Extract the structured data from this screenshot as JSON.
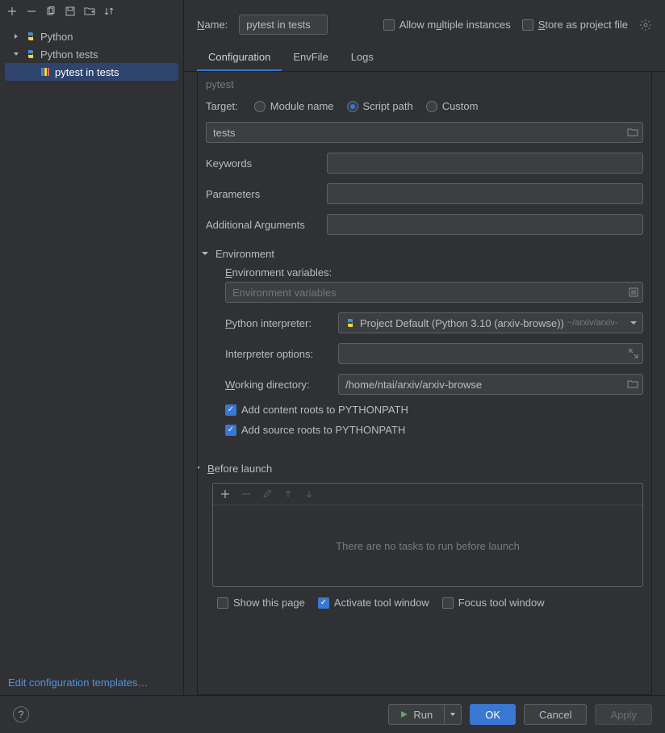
{
  "toolbar": {
    "icons": [
      "add",
      "remove",
      "copy",
      "save",
      "folder",
      "sort"
    ]
  },
  "tree": {
    "root1": "Python",
    "root2": "Python tests",
    "leaf": "pytest in tests"
  },
  "sidebar_link": "Edit configuration templates…",
  "header": {
    "name_label": "Name:",
    "name_value": "pytest in tests",
    "allow_multiple": "Allow multiple instances",
    "store_project": "Store as project file"
  },
  "tabs": {
    "t1": "Configuration",
    "t2": "EnvFile",
    "t3": "Logs"
  },
  "form": {
    "pytest_title": "pytest",
    "target_label": "Target:",
    "radios": {
      "module": "Module name",
      "script": "Script path",
      "custom": "Custom"
    },
    "target_value": "tests",
    "keywords_label": "Keywords",
    "parameters_label": "Parameters",
    "addl_args_label": "Additional Arguments",
    "env_section": "Environment",
    "env_vars_label": "Environment variables:",
    "env_vars_placeholder": "Environment variables",
    "interpreter_label": "Python interpreter:",
    "interpreter_value": "Project Default (Python 3.10 (arxiv-browse))",
    "interpreter_suffix": "~/arxiv/arxiv-",
    "interp_options_label": "Interpreter options:",
    "workdir_label": "Working directory:",
    "workdir_value": "/home/ntai/arxiv/arxiv-browse",
    "content_roots": "Add content roots to PYTHONPATH",
    "source_roots": "Add source roots to PYTHONPATH",
    "before_launch": "Before launch",
    "before_empty": "There are no tasks to run before launch",
    "show_page": "Show this page",
    "activate_tool": "Activate tool window",
    "focus_tool": "Focus tool window"
  },
  "footer": {
    "run": "Run",
    "ok": "OK",
    "cancel": "Cancel",
    "apply": "Apply"
  }
}
